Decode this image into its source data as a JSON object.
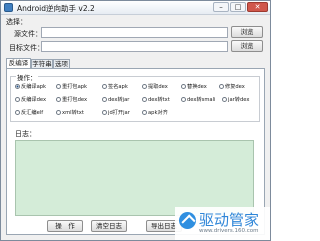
{
  "window": {
    "title": "Android逆向助手 v2.2",
    "controls": {
      "minimize": "–",
      "maximize": "□",
      "close": "✕"
    }
  },
  "file_select": {
    "group_label": "选择：",
    "source_label": "源文件：",
    "source_value": "",
    "target_label": "目标文件：",
    "target_value": "",
    "browse_label": "浏览"
  },
  "tabs": [
    {
      "label": "反编译",
      "active": true
    },
    {
      "label": "字符串",
      "active": false
    },
    {
      "label": "选项",
      "active": false
    }
  ],
  "operations": {
    "group_label": "操作：",
    "rows": [
      [
        "反编译apk",
        "重打包apk",
        "签名apk",
        "提取dex",
        "替换dex",
        "修复dex"
      ],
      [
        "反编译dex",
        "重打包dex",
        "dex转jar",
        "dex转txt",
        "dex转smali",
        "jar转dex"
      ],
      [
        "反汇编elf",
        "xml转txt",
        "jd打开jar",
        "apk对齐"
      ]
    ],
    "selected": "反编译apk"
  },
  "log": {
    "label": "日志：",
    "content": ""
  },
  "actions": {
    "run": "操　作",
    "clear_log": "清空日志",
    "export_log": "导出日志"
  },
  "watermark": {
    "brand": "驱动管家",
    "url": "www.drivers.160.com"
  },
  "colors": {
    "log_background": "#d4ecd8",
    "watermark_blue": "#2f86d8"
  }
}
